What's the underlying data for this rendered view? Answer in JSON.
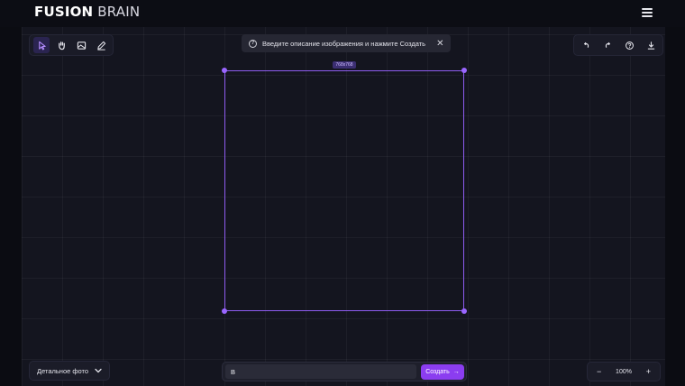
{
  "header": {
    "logo_bold": "FUSION",
    "logo_light": "BRAIN",
    "menu_icon": "hamburger-icon"
  },
  "toolbar_left": {
    "tools": [
      {
        "name": "cursor-icon",
        "active": true
      },
      {
        "name": "hand-icon",
        "active": false
      },
      {
        "name": "image-upload-icon",
        "active": false
      },
      {
        "name": "pencil-icon",
        "active": false
      }
    ]
  },
  "toolbar_right": {
    "tools": [
      {
        "name": "undo-icon"
      },
      {
        "name": "redo-icon"
      },
      {
        "name": "help-icon"
      },
      {
        "name": "download-icon"
      }
    ]
  },
  "hint": {
    "text": "Введите описание изображения и нажмите Создать",
    "close": "✕"
  },
  "frame": {
    "size_label": "768x768"
  },
  "style_selector": {
    "value": "Детальное фото"
  },
  "prompt": {
    "value": "В",
    "placeholder": ""
  },
  "create_button": {
    "label": "Создать",
    "arrow": "→"
  },
  "zoom": {
    "minus": "−",
    "value": "100%",
    "plus": "+"
  },
  "colors": {
    "accent": "#8b3df0",
    "frame": "#8e5cf0",
    "background": "#14151f"
  }
}
